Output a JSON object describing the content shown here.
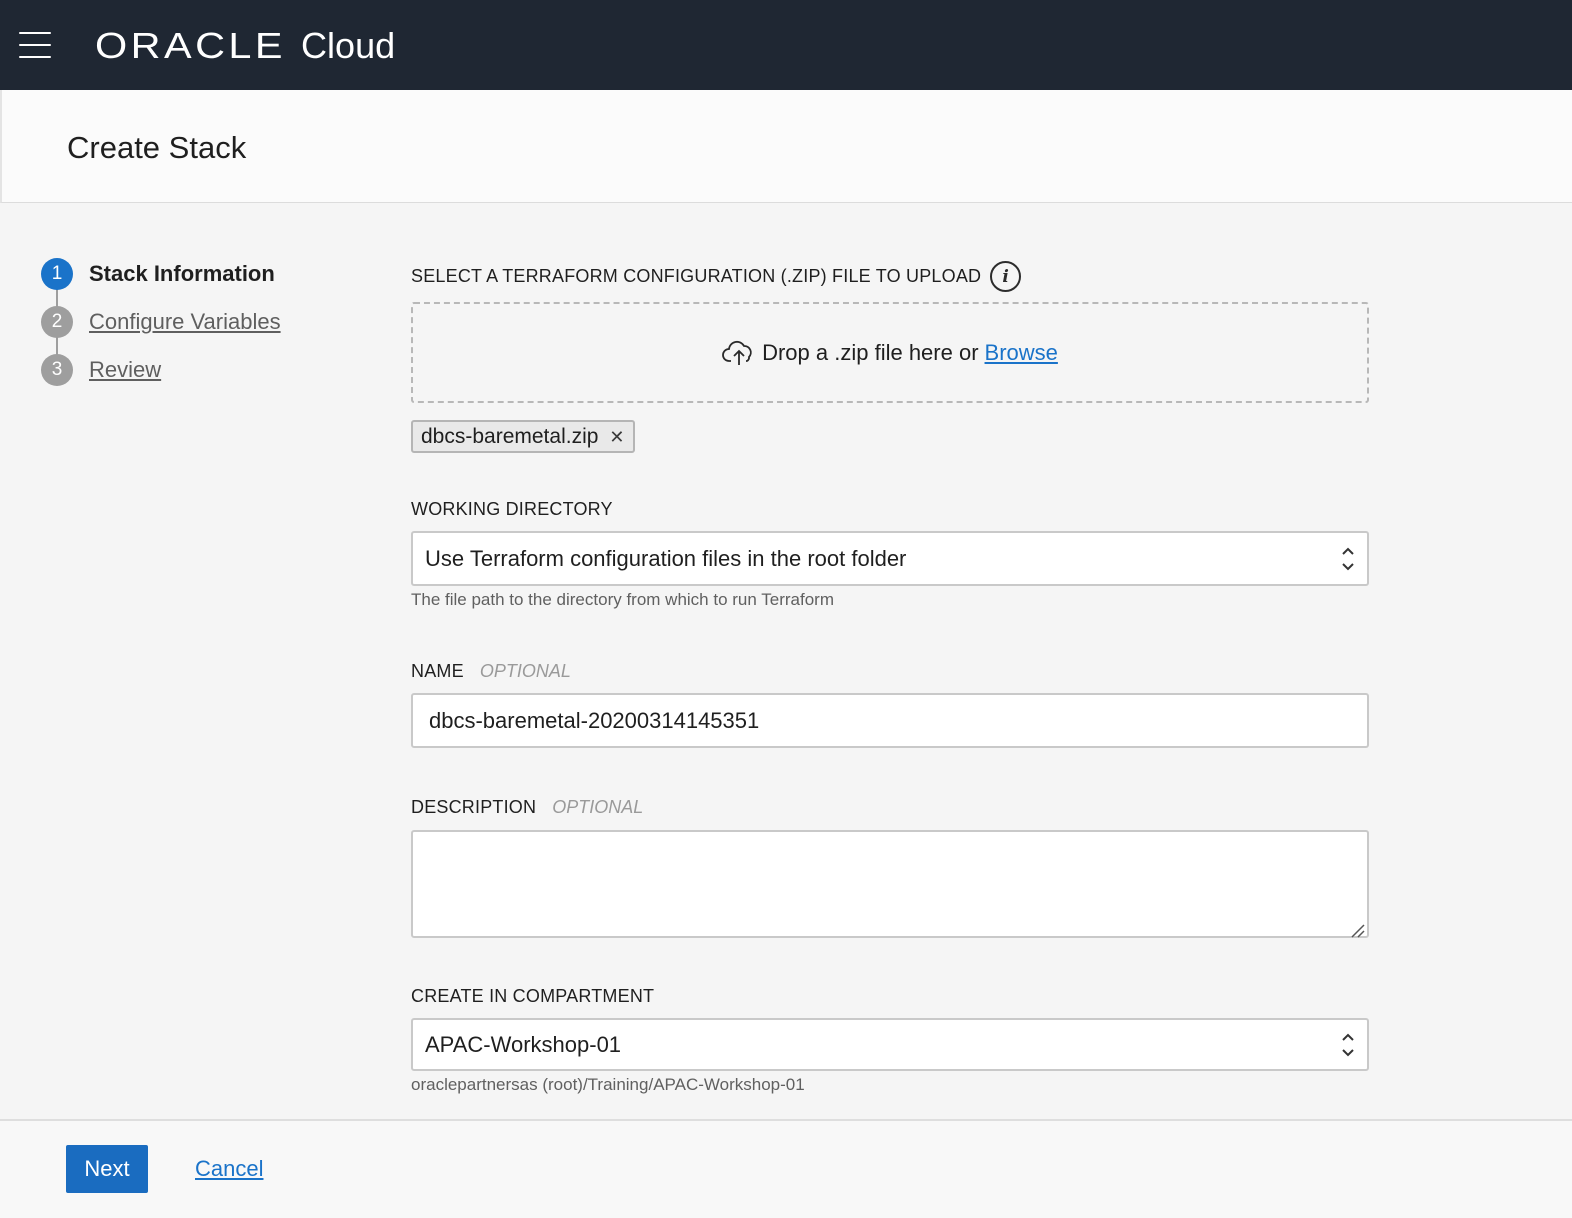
{
  "header": {
    "brand_oracle": "ORACLE",
    "brand_cloud": "Cloud"
  },
  "page": {
    "title": "Create Stack"
  },
  "steps": [
    {
      "number": "1",
      "label": "Stack Information",
      "active": true
    },
    {
      "number": "2",
      "label": "Configure Variables",
      "active": false
    },
    {
      "number": "3",
      "label": "Review",
      "active": false
    }
  ],
  "upload": {
    "label": "SELECT A TERRAFORM CONFIGURATION (.ZIP) FILE TO UPLOAD",
    "info_icon": "info-icon",
    "drop_text": "Drop a .zip file here or",
    "browse_label": "Browse",
    "file_name": "dbcs-baremetal.zip"
  },
  "working_directory": {
    "label": "WORKING DIRECTORY",
    "value": "Use Terraform configuration files in the root folder",
    "hint": "The file path to the directory from which to run Terraform"
  },
  "name": {
    "label": "NAME",
    "optional": "OPTIONAL",
    "value": "dbcs-baremetal-20200314145351"
  },
  "description": {
    "label": "DESCRIPTION",
    "optional": "OPTIONAL",
    "value": ""
  },
  "compartment": {
    "label": "CREATE IN COMPARTMENT",
    "value": "APAC-Workshop-01",
    "hint": "oraclepartnersas (root)/Training/APAC-Workshop-01"
  },
  "footer": {
    "next_label": "Next",
    "cancel_label": "Cancel"
  },
  "colors": {
    "header_bg": "#1f2733",
    "accent": "#1a73c9",
    "primary_button": "#1a6cc0"
  }
}
